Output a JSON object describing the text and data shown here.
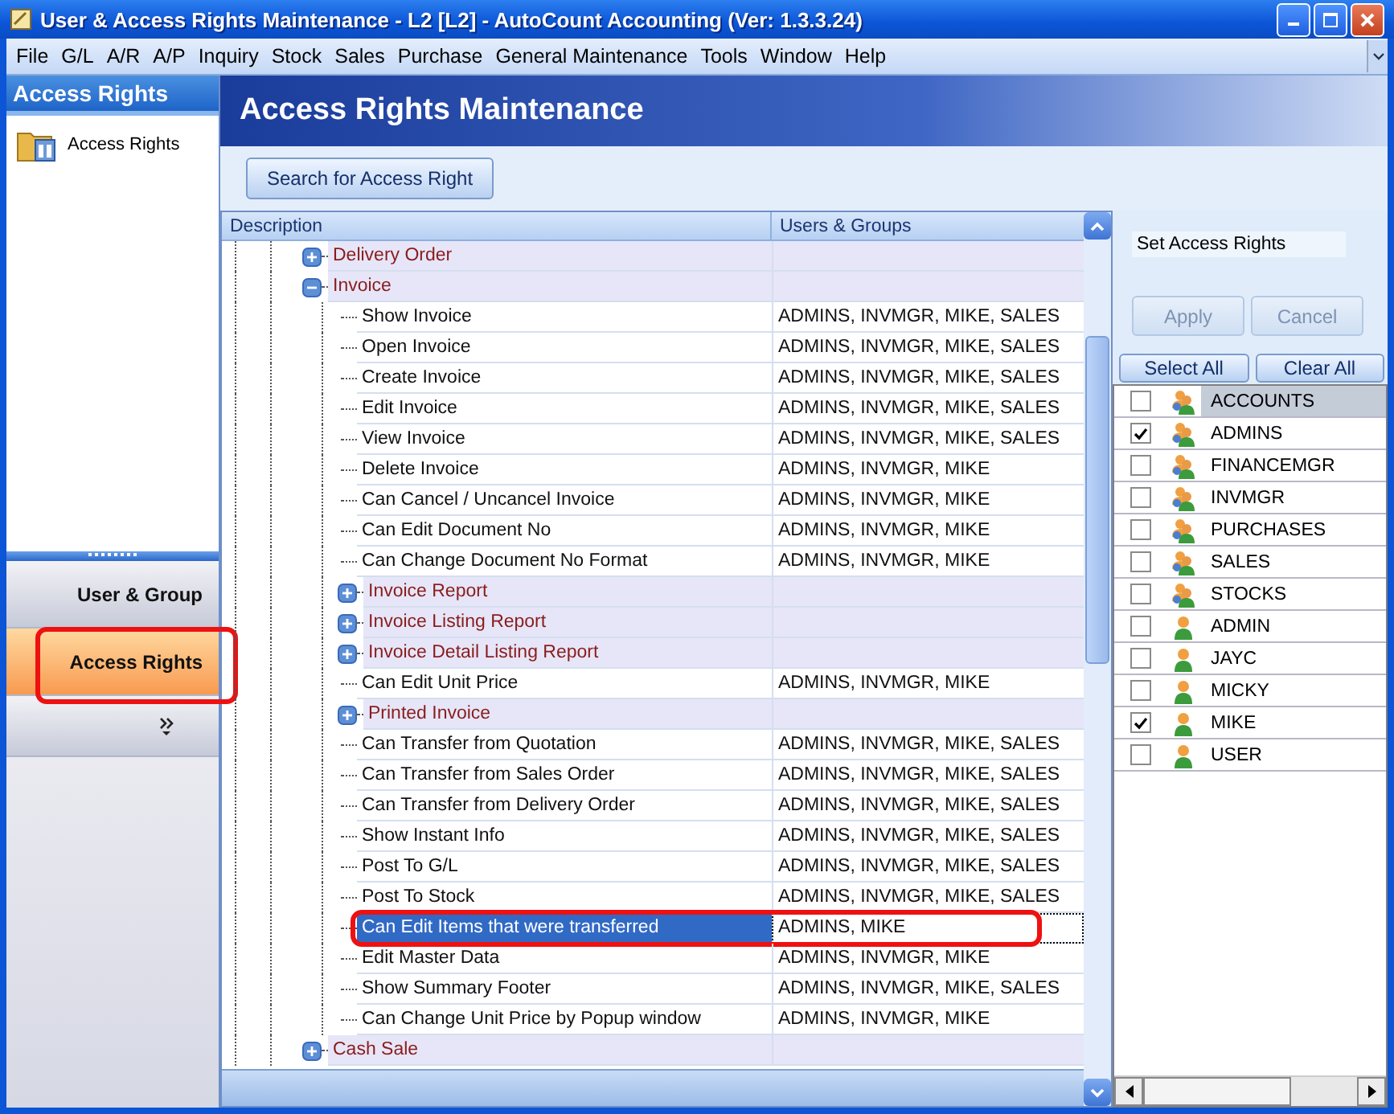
{
  "window": {
    "title": "User & Access Rights Maintenance - L2 [L2] - AutoCount Accounting (Ver: 1.3.3.24)"
  },
  "menu": [
    "File",
    "G/L",
    "A/R",
    "A/P",
    "Inquiry",
    "Stock",
    "Sales",
    "Purchase",
    "General Maintenance",
    "Tools",
    "Window",
    "Help"
  ],
  "sidebar": {
    "title": "Access Rights",
    "items": [
      {
        "label": "Access Rights"
      }
    ],
    "nav": [
      {
        "label": "User & Group",
        "selected": false,
        "annotated": false
      },
      {
        "label": "Access Rights",
        "selected": true,
        "annotated": true
      }
    ]
  },
  "header": {
    "title": "Access Rights Maintenance"
  },
  "search_button": "Search for Access Right",
  "tree": {
    "columns": [
      "Description",
      "Users & Groups"
    ],
    "items": [
      {
        "label": "Delivery Order",
        "kind": "group",
        "expanded": false
      },
      {
        "label": "Invoice",
        "kind": "group",
        "expanded": true,
        "children": [
          {
            "label": "Show Invoice",
            "kind": "right",
            "users": "ADMINS, INVMGR, MIKE, SALES",
            "selected": false,
            "annotated": false
          },
          {
            "label": "Open Invoice",
            "kind": "right",
            "users": "ADMINS, INVMGR, MIKE, SALES",
            "selected": false,
            "annotated": false
          },
          {
            "label": "Create Invoice",
            "kind": "right",
            "users": "ADMINS, INVMGR, MIKE, SALES",
            "selected": false,
            "annotated": false
          },
          {
            "label": "Edit Invoice",
            "kind": "right",
            "users": "ADMINS, INVMGR, MIKE, SALES",
            "selected": false,
            "annotated": false
          },
          {
            "label": "View Invoice",
            "kind": "right",
            "users": "ADMINS, INVMGR, MIKE, SALES",
            "selected": false,
            "annotated": false
          },
          {
            "label": "Delete Invoice",
            "kind": "right",
            "users": "ADMINS, INVMGR, MIKE",
            "selected": false,
            "annotated": false
          },
          {
            "label": "Can Cancel / Uncancel Invoice",
            "kind": "right",
            "users": "ADMINS, INVMGR, MIKE",
            "selected": false,
            "annotated": false
          },
          {
            "label": "Can Edit Document No",
            "kind": "right",
            "users": "ADMINS, INVMGR, MIKE",
            "selected": false,
            "annotated": false
          },
          {
            "label": "Can Change Document No Format",
            "kind": "right",
            "users": "ADMINS, INVMGR, MIKE",
            "selected": false,
            "annotated": false
          },
          {
            "label": "Invoice Report",
            "kind": "group",
            "expanded": false
          },
          {
            "label": "Invoice Listing Report",
            "kind": "group",
            "expanded": false
          },
          {
            "label": "Invoice Detail Listing Report",
            "kind": "group",
            "expanded": false
          },
          {
            "label": "Can Edit Unit Price",
            "kind": "right",
            "users": "ADMINS, INVMGR, MIKE",
            "selected": false,
            "annotated": false
          },
          {
            "label": "Printed Invoice",
            "kind": "group",
            "expanded": false
          },
          {
            "label": "Can Transfer from Quotation",
            "kind": "right",
            "users": "ADMINS, INVMGR, MIKE, SALES",
            "selected": false,
            "annotated": false
          },
          {
            "label": "Can Transfer from Sales Order",
            "kind": "right",
            "users": "ADMINS, INVMGR, MIKE, SALES",
            "selected": false,
            "annotated": false
          },
          {
            "label": "Can Transfer from Delivery Order",
            "kind": "right",
            "users": "ADMINS, INVMGR, MIKE, SALES",
            "selected": false,
            "annotated": false
          },
          {
            "label": "Show Instant Info",
            "kind": "right",
            "users": "ADMINS, INVMGR, MIKE, SALES",
            "selected": false,
            "annotated": false
          },
          {
            "label": "Post To G/L",
            "kind": "right",
            "users": "ADMINS, INVMGR, MIKE, SALES",
            "selected": false,
            "annotated": false
          },
          {
            "label": "Post To Stock",
            "kind": "right",
            "users": "ADMINS, INVMGR, MIKE, SALES",
            "selected": false,
            "annotated": false
          },
          {
            "label": "Can Edit Items that were transferred",
            "kind": "right",
            "users": "ADMINS, MIKE",
            "selected": true,
            "annotated": true
          },
          {
            "label": "Edit Master Data",
            "kind": "right",
            "users": "ADMINS, INVMGR, MIKE",
            "selected": false,
            "annotated": false
          },
          {
            "label": "Show Summary Footer",
            "kind": "right",
            "users": "ADMINS, INVMGR, MIKE, SALES",
            "selected": false,
            "annotated": false
          },
          {
            "label": "Can Change Unit Price by Popup window",
            "kind": "right",
            "users": "ADMINS, INVMGR, MIKE",
            "selected": false,
            "annotated": false
          }
        ]
      },
      {
        "label": "Cash Sale",
        "kind": "group",
        "expanded": false
      }
    ]
  },
  "rights_panel": {
    "label": "Set Access Rights",
    "buttons": [
      {
        "label": "Apply",
        "disabled": true
      },
      {
        "label": "Cancel",
        "disabled": true
      }
    ],
    "select_all": "Select All",
    "clear_all": "Clear All",
    "users": [
      {
        "name": "ACCOUNTS",
        "kind": "group",
        "checked": false,
        "selected": true
      },
      {
        "name": "ADMINS",
        "kind": "group",
        "checked": true,
        "selected": false
      },
      {
        "name": "FINANCEMGR",
        "kind": "group",
        "checked": false,
        "selected": false
      },
      {
        "name": "INVMGR",
        "kind": "group",
        "checked": false,
        "selected": false
      },
      {
        "name": "PURCHASES",
        "kind": "group",
        "checked": false,
        "selected": false
      },
      {
        "name": "SALES",
        "kind": "group",
        "checked": false,
        "selected": false
      },
      {
        "name": "STOCKS",
        "kind": "group",
        "checked": false,
        "selected": false
      },
      {
        "name": "ADMIN",
        "kind": "user",
        "checked": false,
        "selected": false
      },
      {
        "name": "JAYC",
        "kind": "user",
        "checked": false,
        "selected": false
      },
      {
        "name": "MICKY",
        "kind": "user",
        "checked": false,
        "selected": false
      },
      {
        "name": "MIKE",
        "kind": "user",
        "checked": true,
        "selected": false
      },
      {
        "name": "USER",
        "kind": "user",
        "checked": false,
        "selected": false
      }
    ]
  }
}
